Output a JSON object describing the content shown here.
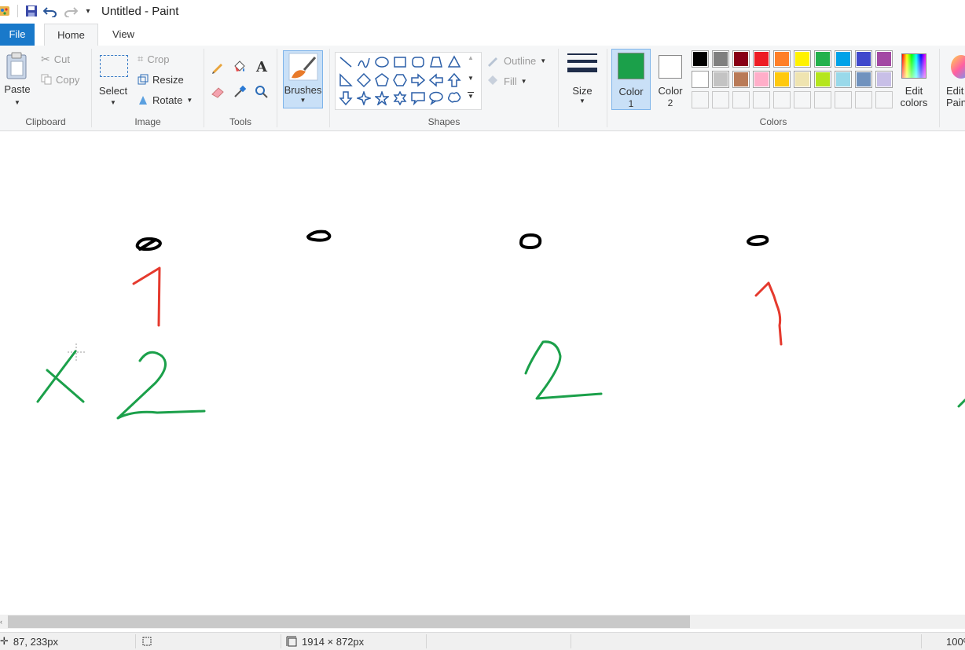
{
  "window": {
    "title": "Untitled - Paint"
  },
  "tabs": [
    {
      "label": "File"
    },
    {
      "label": "Home"
    },
    {
      "label": "View"
    }
  ],
  "clipboard": {
    "paste_label": "Paste",
    "cut_label": "Cut",
    "copy_label": "Copy",
    "group_label": "Clipboard"
  },
  "image": {
    "select_label": "Select",
    "crop_label": "Crop",
    "resize_label": "Resize",
    "rotate_label": "Rotate",
    "group_label": "Image"
  },
  "tools": {
    "group_label": "Tools"
  },
  "brushes": {
    "label": "Brushes"
  },
  "shapes": {
    "outline_label": "Outline",
    "fill_label": "Fill",
    "group_label": "Shapes"
  },
  "size": {
    "label": "Size"
  },
  "colors": {
    "color1_label": "Color",
    "color1_num": "1",
    "color2_label": "Color",
    "color2_num": "2",
    "edit_label_1": "Edit",
    "edit_label_2": "colors",
    "edit_paint3d_1": "Edit",
    "edit_paint3d_2": "Pain",
    "group_label": "Colors",
    "color1_value": "#1ba04a",
    "color2_value": "#ffffff",
    "palette_row1": [
      "#000000",
      "#7f7f7f",
      "#880015",
      "#ed1c24",
      "#ff7f27",
      "#fff200",
      "#22b14c",
      "#00a2e8",
      "#3f48cc",
      "#a349a4"
    ],
    "palette_row2": [
      "#ffffff",
      "#c3c3c3",
      "#b97a57",
      "#ffaec9",
      "#ffc90e",
      "#efe4b0",
      "#b5e61d",
      "#99d9ea",
      "#7092be",
      "#c8bfe7"
    ]
  },
  "status": {
    "cursor_pos": "87, 233px",
    "canvas_size": "1914 × 872px",
    "zoom": "100%"
  }
}
